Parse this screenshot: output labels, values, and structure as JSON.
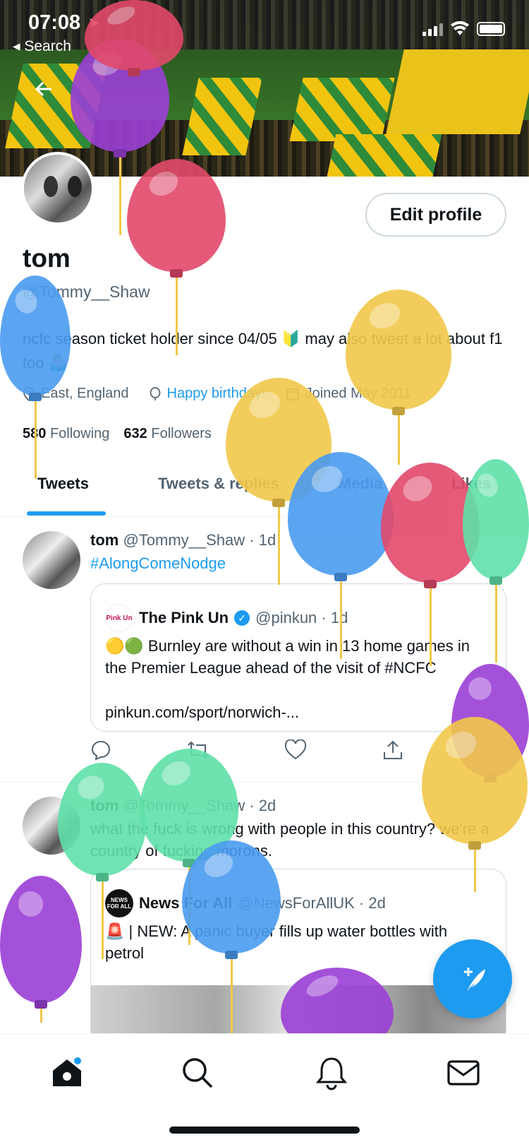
{
  "status_bar": {
    "time": "07:08",
    "back_label": "◂ Search"
  },
  "profile": {
    "name": "tom",
    "handle": "@Tommy__Shaw",
    "edit_button": "Edit profile",
    "bio": "ncfc season ticket holder since 04/05 🔰 may also tweet a lot about f1 too 🤷🏼‍♂️",
    "location": "East, England",
    "birthday": "Happy birthday!",
    "joined": "Joined May 2011",
    "following_count": "580",
    "following_label": "Following",
    "followers_count": "632",
    "followers_label": "Followers"
  },
  "tabs": [
    "Tweets",
    "Tweets & replies",
    "Media",
    "Likes"
  ],
  "tweets": [
    {
      "author": "tom",
      "meta": "@Tommy__Shaw · 1d",
      "tag": "#AlongComeNodge",
      "quote": {
        "logo": "Pink Un",
        "name": "The Pink Un",
        "meta": "@pinkun · 1d",
        "text": "🟡🟢 Burnley are without a win in 13 home games in the Premier League ahead of the visit of #NCFC",
        "link": "pinkun.com/sport/norwich-..."
      }
    },
    {
      "author": "tom",
      "meta": "@Tommy__Shaw · 2d",
      "text": "what the fuck is wrong with people in this country? we're a country of fucking morons.",
      "quote": {
        "logo": "NEWS FOR ALL",
        "name": "News For All",
        "meta": "@NewsForAllUK · 2d",
        "text": "🚨 | NEW: A panic buyer fills up water bottles with petrol"
      }
    }
  ],
  "icons": {
    "back": "arrow-left-icon",
    "reply": "reply-icon",
    "retweet": "retweet-icon",
    "like": "heart-icon",
    "share": "share-icon",
    "compose": "compose-icon",
    "nav": [
      "home-icon",
      "search-icon",
      "bell-icon",
      "mail-icon"
    ]
  },
  "colors": {
    "accent": "#1d9bf0",
    "text": "#0f1419",
    "muted": "#536471"
  }
}
